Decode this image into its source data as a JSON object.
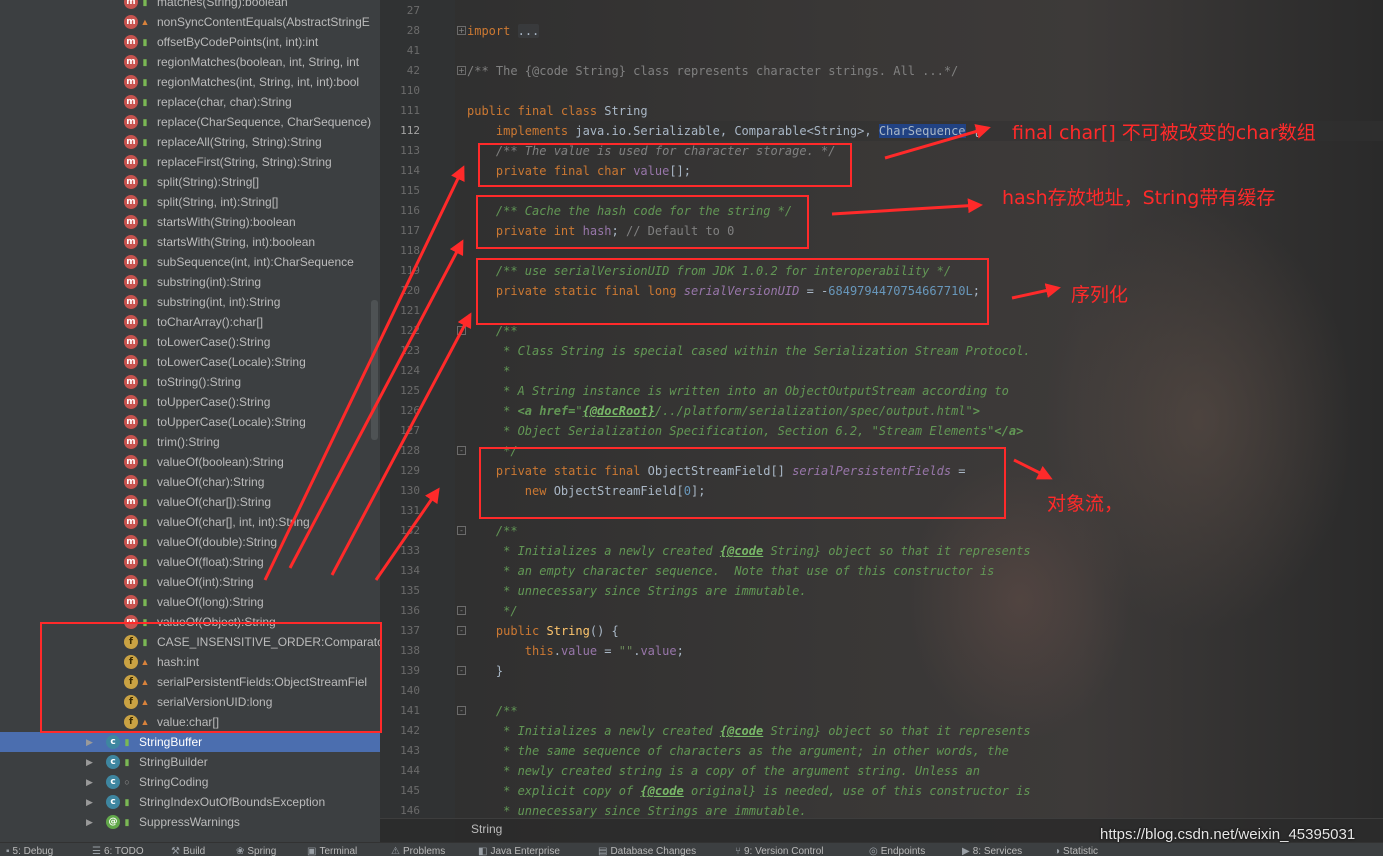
{
  "structure": {
    "items": [
      {
        "badge": "m",
        "vis": "public",
        "label": "matches(String):boolean"
      },
      {
        "badge": "m",
        "vis": "private",
        "label": "nonSyncContentEquals(AbstractStringE"
      },
      {
        "badge": "m",
        "vis": "public",
        "label": "offsetByCodePoints(int, int):int"
      },
      {
        "badge": "m",
        "vis": "public",
        "label": "regionMatches(boolean, int, String, int"
      },
      {
        "badge": "m",
        "vis": "public",
        "label": "regionMatches(int, String, int, int):bool"
      },
      {
        "badge": "m",
        "vis": "public",
        "label": "replace(char, char):String"
      },
      {
        "badge": "m",
        "vis": "public",
        "label": "replace(CharSequence, CharSequence)"
      },
      {
        "badge": "m",
        "vis": "public",
        "label": "replaceAll(String, String):String"
      },
      {
        "badge": "m",
        "vis": "public",
        "label": "replaceFirst(String, String):String"
      },
      {
        "badge": "m",
        "vis": "public",
        "label": "split(String):String[]"
      },
      {
        "badge": "m",
        "vis": "public",
        "label": "split(String, int):String[]"
      },
      {
        "badge": "m",
        "vis": "public",
        "label": "startsWith(String):boolean"
      },
      {
        "badge": "m",
        "vis": "public",
        "label": "startsWith(String, int):boolean"
      },
      {
        "badge": "m",
        "vis": "public",
        "label": "subSequence(int, int):CharSequence"
      },
      {
        "badge": "m",
        "vis": "public",
        "label": "substring(int):String"
      },
      {
        "badge": "m",
        "vis": "public",
        "label": "substring(int, int):String"
      },
      {
        "badge": "m",
        "vis": "public",
        "label": "toCharArray():char[]"
      },
      {
        "badge": "m",
        "vis": "public",
        "label": "toLowerCase():String"
      },
      {
        "badge": "m",
        "vis": "public",
        "label": "toLowerCase(Locale):String"
      },
      {
        "badge": "m",
        "vis": "public",
        "label": "toString():String"
      },
      {
        "badge": "m",
        "vis": "public",
        "label": "toUpperCase():String"
      },
      {
        "badge": "m",
        "vis": "public",
        "label": "toUpperCase(Locale):String"
      },
      {
        "badge": "m",
        "vis": "public",
        "label": "trim():String"
      },
      {
        "badge": "m",
        "vis": "public",
        "label": "valueOf(boolean):String"
      },
      {
        "badge": "m",
        "vis": "public",
        "label": "valueOf(char):String"
      },
      {
        "badge": "m",
        "vis": "public",
        "label": "valueOf(char[]):String"
      },
      {
        "badge": "m",
        "vis": "public",
        "label": "valueOf(char[], int, int):String"
      },
      {
        "badge": "m",
        "vis": "public",
        "label": "valueOf(double):String"
      },
      {
        "badge": "m",
        "vis": "public",
        "label": "valueOf(float):String"
      },
      {
        "badge": "m",
        "vis": "public",
        "label": "valueOf(int):String"
      },
      {
        "badge": "m",
        "vis": "public",
        "label": "valueOf(long):String"
      },
      {
        "badge": "m",
        "vis": "public",
        "label": "valueOf(Object):String"
      },
      {
        "badge": "f",
        "vis": "public",
        "label": "CASE_INSENSITIVE_ORDER:Comparato"
      },
      {
        "badge": "f",
        "vis": "private",
        "label": "hash:int"
      },
      {
        "badge": "f",
        "vis": "private",
        "label": "serialPersistentFields:ObjectStreamFiel"
      },
      {
        "badge": "f",
        "vis": "private",
        "label": "serialVersionUID:long"
      },
      {
        "badge": "f",
        "vis": "private",
        "label": "value:char[]"
      }
    ],
    "classes": [
      {
        "badge": "c",
        "vis": "public",
        "label": "StringBuffer",
        "selected": true
      },
      {
        "badge": "c",
        "vis": "public",
        "label": "StringBuilder",
        "selected": false
      },
      {
        "badge": "c",
        "vis": "package",
        "label": "StringCoding",
        "selected": false
      },
      {
        "badge": "c",
        "vis": "public",
        "label": "StringIndexOutOfBoundsException",
        "selected": false
      },
      {
        "badge": "a",
        "vis": "public",
        "label": "SuppressWarnings",
        "selected": false
      }
    ]
  },
  "editor": {
    "breadcrumb": "String",
    "lines": [
      {
        "n": "27",
        "fold": "",
        "html": ""
      },
      {
        "n": "28",
        "fold": "+",
        "html": "<span class='k'>import</span> <span class='fold-text'>...</span>"
      },
      {
        "n": "41",
        "fold": "",
        "html": ""
      },
      {
        "n": "42",
        "fold": "+",
        "html": "<span class='cm'>/** The {@code String} class represents character strings. All ...*/</span>"
      },
      {
        "n": "110",
        "fold": "",
        "html": ""
      },
      {
        "n": "111",
        "fold": "",
        "html": "<span class='k'>public final class</span> String"
      },
      {
        "n": "112",
        "fold": "",
        "html": "    <span class='k'>implements</span> java.io.Serializable, Comparable&lt;String&gt;, <span class='hl'>CharSequence</span> {"
      },
      {
        "n": "113",
        "fold": "",
        "html": "    <span class='cm'><i>/** The value is used for character storage. */</i></span>"
      },
      {
        "n": "114",
        "fold": "",
        "html": "    <span class='k'>private final char</span> <span class='fld'>value</span>[];"
      },
      {
        "n": "115",
        "fold": "",
        "html": ""
      },
      {
        "n": "116",
        "fold": "",
        "html": "    <span class='dc'>/** Cache the hash code for the string */</span>"
      },
      {
        "n": "117",
        "fold": "",
        "html": "    <span class='k'>private int</span> <span class='fld'>hash</span>; <span class='cm'>// Default to 0</span>"
      },
      {
        "n": "118",
        "fold": "",
        "html": ""
      },
      {
        "n": "119",
        "fold": "",
        "html": "    <span class='dc'>/** use serialVersionUID from JDK 1.0.2 for interoperability */</span>"
      },
      {
        "n": "120",
        "fold": "",
        "html": "    <span class='k'>private static final long</span> <span class='fldi'>serialVersionUID</span> = -<span class='num'>6849794470754667710L</span>;"
      },
      {
        "n": "121",
        "fold": "",
        "html": ""
      },
      {
        "n": "122",
        "fold": "-",
        "html": "    <span class='dc'>/**</span>"
      },
      {
        "n": "123",
        "fold": "",
        "html": "     <span class='dc'>* Class String is special cased within the Serialization Stream Protocol.</span>"
      },
      {
        "n": "124",
        "fold": "",
        "html": "     <span class='dc'>*</span>"
      },
      {
        "n": "125",
        "fold": "",
        "html": "     <span class='dc'>* A String instance is written into an ObjectOutputStream according to</span>"
      },
      {
        "n": "126",
        "fold": "",
        "html": "     <span class='dc'>* <b>&lt;a href=</b>\"<span class='dt'>{@docRoot}</span>/../platform/serialization/spec/output.html\"<b>&gt;</b></span>"
      },
      {
        "n": "127",
        "fold": "",
        "html": "     <span class='dc'>* Object Serialization Specification, Section 6.2, \"Stream Elements\"<b>&lt;/a&gt;</b></span>"
      },
      {
        "n": "128",
        "fold": "-",
        "html": "     <span class='dc'>*/</span>"
      },
      {
        "n": "129",
        "fold": "",
        "html": "    <span class='k'>private static final</span> ObjectStreamField[] <span class='fldi'>serialPersistentFields</span> ="
      },
      {
        "n": "130",
        "fold": "",
        "html": "        <span class='k'>new</span> ObjectStreamField[<span class='num'>0</span>];"
      },
      {
        "n": "131",
        "fold": "",
        "html": ""
      },
      {
        "n": "132",
        "fold": "-",
        "html": "    <span class='dc'>/**</span>"
      },
      {
        "n": "133",
        "fold": "",
        "html": "     <span class='dc'>* Initializes a newly created <span class='dt'>{@code</span> String} object so that it represents</span>"
      },
      {
        "n": "134",
        "fold": "",
        "html": "     <span class='dc'>* an empty character sequence.  Note that use of this constructor is</span>"
      },
      {
        "n": "135",
        "fold": "",
        "html": "     <span class='dc'>* unnecessary since Strings are immutable.</span>"
      },
      {
        "n": "136",
        "fold": "-",
        "html": "     <span class='dc'>*/</span>"
      },
      {
        "n": "137",
        "fold": "-",
        "html": "    <span class='k'>public</span> <span style='color:#ffc66d'>String</span>() {"
      },
      {
        "n": "138",
        "fold": "",
        "html": "        <span class='k'>this</span>.<span class='fld'>value</span> = <span class='str'>\"\"</span>.<span class='fld'>value</span>;"
      },
      {
        "n": "139",
        "fold": "-",
        "html": "    }"
      },
      {
        "n": "140",
        "fold": "",
        "html": ""
      },
      {
        "n": "141",
        "fold": "-",
        "html": "    <span class='dc'>/**</span>"
      },
      {
        "n": "142",
        "fold": "",
        "html": "     <span class='dc'>* Initializes a newly created <span class='dt'>{@code</span> String} object so that it represents</span>"
      },
      {
        "n": "143",
        "fold": "",
        "html": "     <span class='dc'>* the same sequence of characters as the argument; in other words, the</span>"
      },
      {
        "n": "144",
        "fold": "",
        "html": "     <span class='dc'>* newly created string is a copy of the argument string. Unless an</span>"
      },
      {
        "n": "145",
        "fold": "",
        "html": "     <span class='dc'>* explicit copy of <span class='dt'>{@code</span> original} is needed, use of this constructor is</span>"
      },
      {
        "n": "146",
        "fold": "",
        "html": "     <span class='dc'>* unnecessary since Strings are immutable.</span>"
      }
    ]
  },
  "annotations": {
    "note1": "final char[] 不可被改变的char数组",
    "note2": "hash存放地址，String带有缓存",
    "note3": "序列化",
    "note4": "对象流，",
    "color": "#ff2a2a"
  },
  "toolwindows": [
    {
      "icon": "debug-icon",
      "glyph": "▪",
      "label": "5: Debug"
    },
    {
      "icon": "todo-icon",
      "glyph": "☰",
      "label": "6: TODO"
    },
    {
      "icon": "build-icon",
      "glyph": "⚒",
      "label": "Build"
    },
    {
      "icon": "spring-icon",
      "glyph": "❀",
      "label": "Spring"
    },
    {
      "icon": "terminal-icon",
      "glyph": "▣",
      "label": "Terminal"
    },
    {
      "icon": "problems-icon",
      "glyph": "⚠",
      "label": "Problems"
    },
    {
      "icon": "java-enterprise-icon",
      "glyph": "◧",
      "label": "Java Enterprise"
    },
    {
      "icon": "database-changes-icon",
      "glyph": "▤",
      "label": "Database Changes"
    },
    {
      "icon": "version-control-icon",
      "glyph": "⑂",
      "label": "9: Version Control"
    },
    {
      "icon": "endpoints-icon",
      "glyph": "◎",
      "label": "Endpoints"
    },
    {
      "icon": "services-icon",
      "glyph": "▶",
      "label": "8: Services"
    },
    {
      "icon": "statistic-icon",
      "glyph": "◑",
      "label": "Statistic"
    }
  ],
  "watermark": "https://blog.csdn.net/weixin_45395031"
}
